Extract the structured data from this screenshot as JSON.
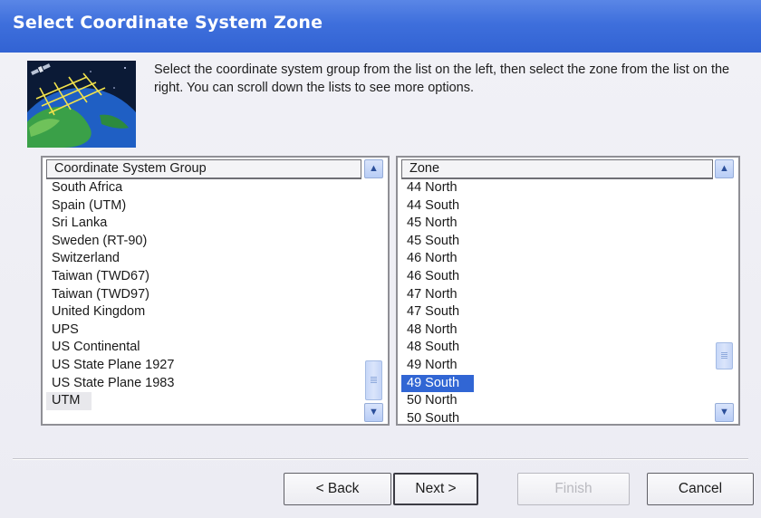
{
  "window": {
    "title": "Select Coordinate System Zone"
  },
  "instructions": "Select the coordinate system group from the list on the left, then select the zone from the list on the right.  You can scroll down the lists to see more options.",
  "group_list": {
    "header": "Coordinate System Group",
    "items": [
      "South Africa",
      "Spain (UTM)",
      "Sri Lanka",
      "Sweden (RT-90)",
      "Switzerland",
      "Taiwan (TWD67)",
      "Taiwan (TWD97)",
      "United Kingdom",
      "UPS",
      "US Continental",
      "US State Plane 1927",
      "US State Plane 1983",
      "UTM"
    ],
    "selected": "UTM",
    "scroll_position": 0.92
  },
  "zone_list": {
    "header": "Zone",
    "items": [
      "44 North",
      "44 South",
      "45 North",
      "45 South",
      "46 North",
      "46 South",
      "47 North",
      "47 South",
      "48 North",
      "48 South",
      "49 North",
      "49 South",
      "50 North",
      "50 South"
    ],
    "selected": "49 South",
    "scroll_position": 0.78
  },
  "buttons": {
    "back": "< Back",
    "next": "Next >",
    "finish": "Finish",
    "cancel": "Cancel"
  },
  "colors": {
    "titlebar": "#3e6fdc",
    "selection": "#3166d4",
    "scroll_button": "#c7d7f8"
  },
  "icons": {
    "dialog_graphic": "satellite-globe-icon",
    "scroll_up": "chevron-up-icon",
    "scroll_down": "chevron-down-icon"
  }
}
